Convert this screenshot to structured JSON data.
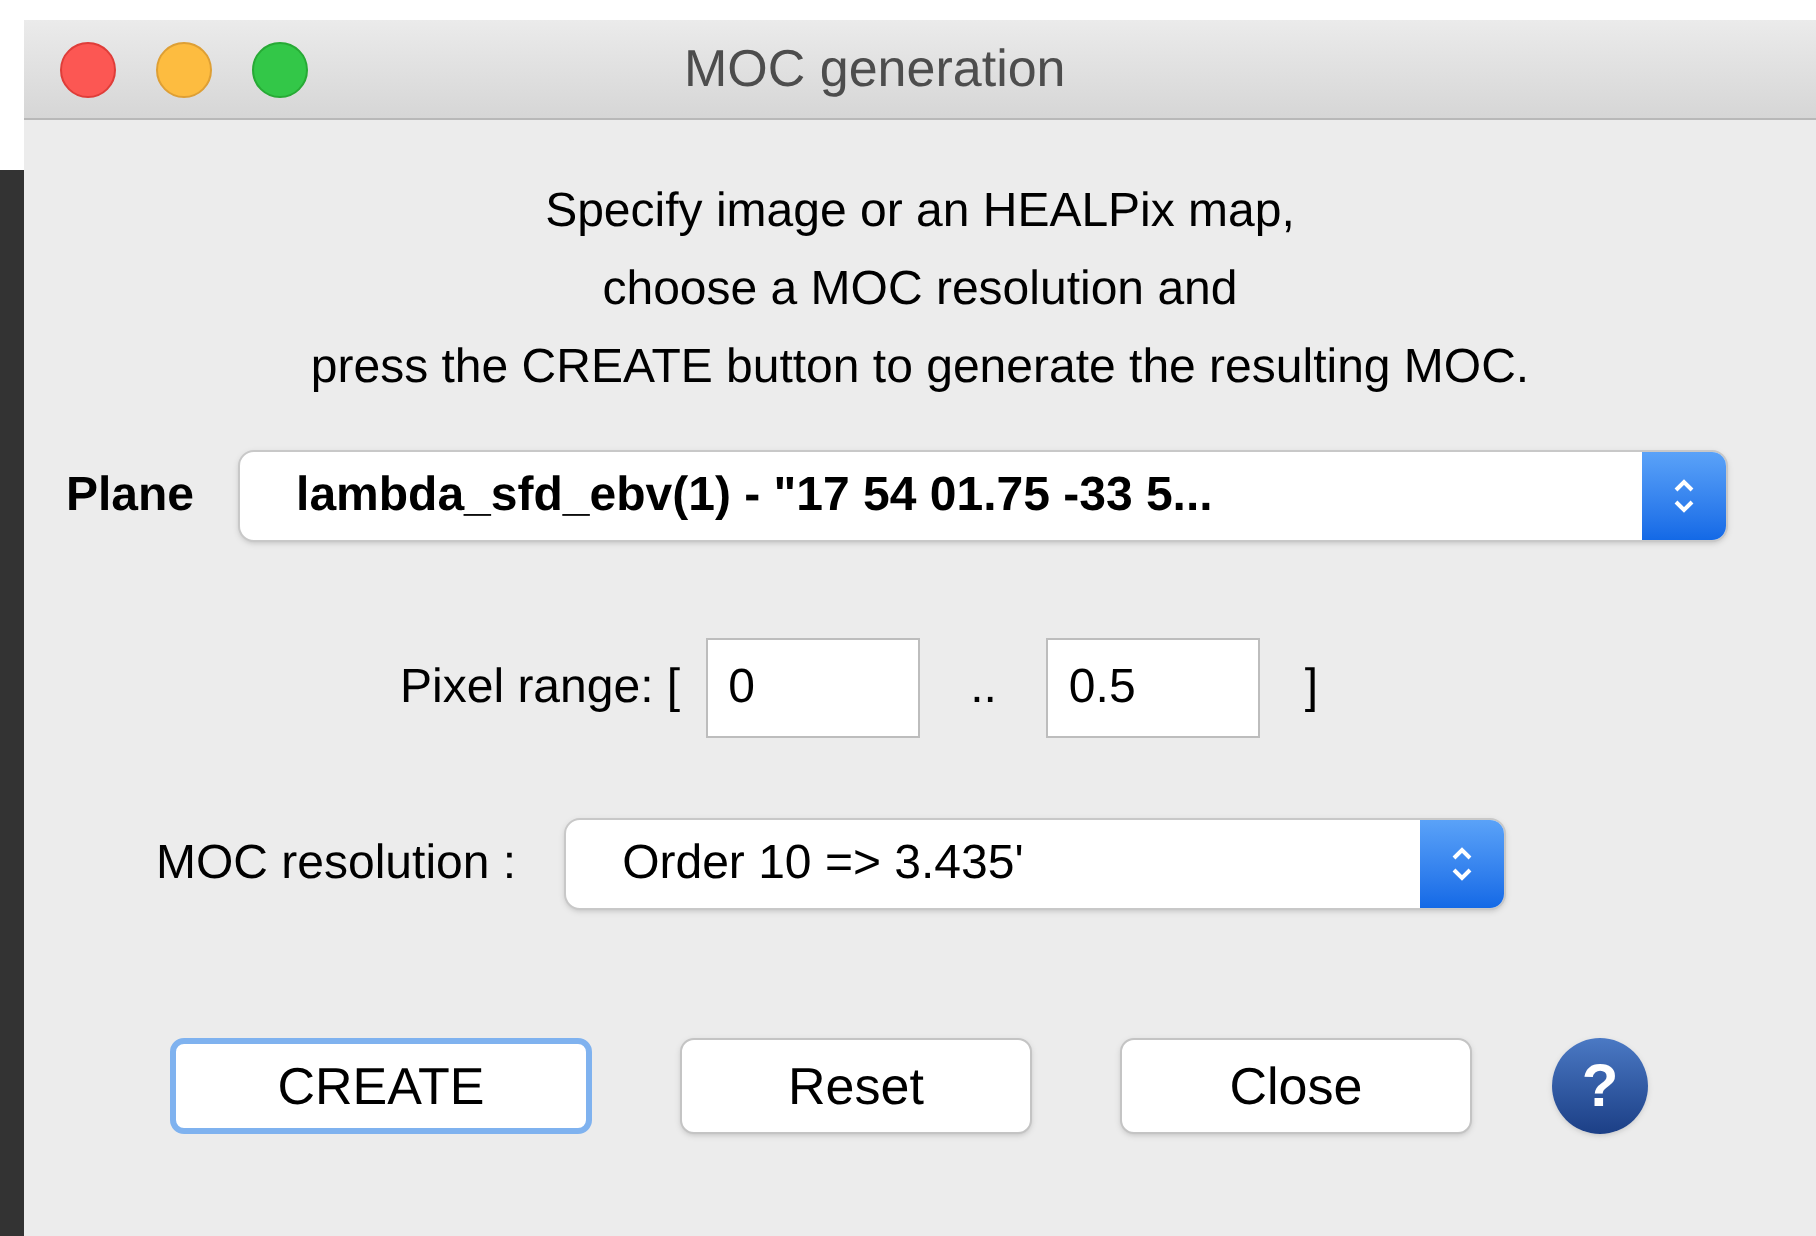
{
  "window": {
    "title": "MOC generation"
  },
  "instructions": [
    "Specify image or an HEALPix map,",
    "choose a MOC resolution and",
    "press the CREATE button to generate the resulting MOC."
  ],
  "plane": {
    "label": "Plane",
    "value": "lambda_sfd_ebv(1) - \"17 54 01.75 -33 5..."
  },
  "pixel_range": {
    "label": "Pixel range: [",
    "min": "0",
    "separator": "..",
    "max": "0.5",
    "close": "]"
  },
  "resolution": {
    "label": "MOC resolution :",
    "value": "Order 10 => 3.435'"
  },
  "buttons": [
    {
      "label": "CREATE",
      "focused": true
    },
    {
      "label": "Reset",
      "focused": false
    },
    {
      "label": "Close",
      "focused": false
    }
  ],
  "help": {
    "label": "?"
  }
}
